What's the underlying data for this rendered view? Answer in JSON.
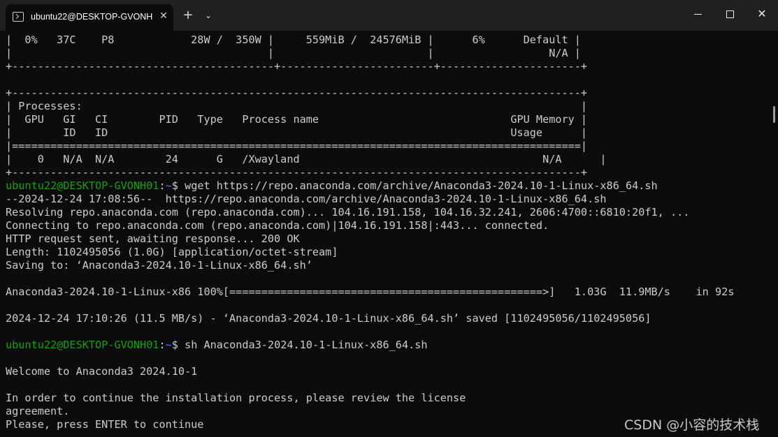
{
  "window": {
    "tab_title": "ubuntu22@DESKTOP-GVONH",
    "tab_icon": "terminal-icon",
    "tab_close": "✕",
    "new_tab": "+",
    "dropdown": "⌄",
    "minimize_icon": "minimize-icon",
    "maximize_icon": "maximize-icon",
    "close": "✕"
  },
  "terminal": {
    "prompt_user": "ubuntu22@DESKTOP-GVONH01",
    "prompt_colon": ":",
    "prompt_path": "~",
    "prompt_symbol": "$",
    "lines": [
      "|  0%   37C    P8            28W /  350W |     559MiB /  24576MiB |      6%      Default |",
      "|                                        |                        |                  N/A |",
      "+-----------------------------------------+------------------------+----------------------+",
      "",
      "+-----------------------------------------------------------------------------------------+",
      "| Processes:                                                                              |",
      "|  GPU   GI   CI        PID   Type   Process name                              GPU Memory |",
      "|        ID   ID                                                               Usage      |",
      "|=========================================================================================|",
      "|    0   N/A  N/A        24      G   /Xwayland                                      N/A      |",
      "+-----------------------------------------------------------------------------------------+",
      "",
      "--2024-12-24 17:08:56--  https://repo.anaconda.com/archive/Anaconda3-2024.10-1-Linux-x86_64.sh",
      "Resolving repo.anaconda.com (repo.anaconda.com)... 104.16.191.158, 104.16.32.241, 2606:4700::6810:20f1, ...",
      "Connecting to repo.anaconda.com (repo.anaconda.com)|104.16.191.158|:443... connected.",
      "HTTP request sent, awaiting response... 200 OK",
      "Length: 1102495056 (1.0G) [application/octet-stream]",
      "Saving to: ‘Anaconda3-2024.10-1-Linux-x86_64.sh’",
      "",
      "Anaconda3-2024.10-1-Linux-x86 100%[=================================================>]   1.03G  11.9MB/s    in 92s",
      "",
      "2024-12-24 17:10:26 (11.5 MB/s) - ‘Anaconda3-2024.10-1-Linux-x86_64.sh’ saved [1102495056/1102495056]",
      "",
      "",
      "",
      "Welcome to Anaconda3 2024.10-1",
      "",
      "In order to continue the installation process, please review the license",
      "agreement.",
      "Please, press ENTER to continue"
    ],
    "command_1": " wget https://repo.anaconda.com/archive/Anaconda3-2024.10-1-Linux-x86_64.sh",
    "command_2": " sh Anaconda3-2024.10-1-Linux-x86_64.sh"
  },
  "watermark": "CSDN @小容的技术栈",
  "colors": {
    "background": "#0c0c0c",
    "titlebar": "#202020",
    "prompt_user": "#13a10e",
    "prompt_path": "#3b78ff",
    "text": "#cccccc"
  }
}
